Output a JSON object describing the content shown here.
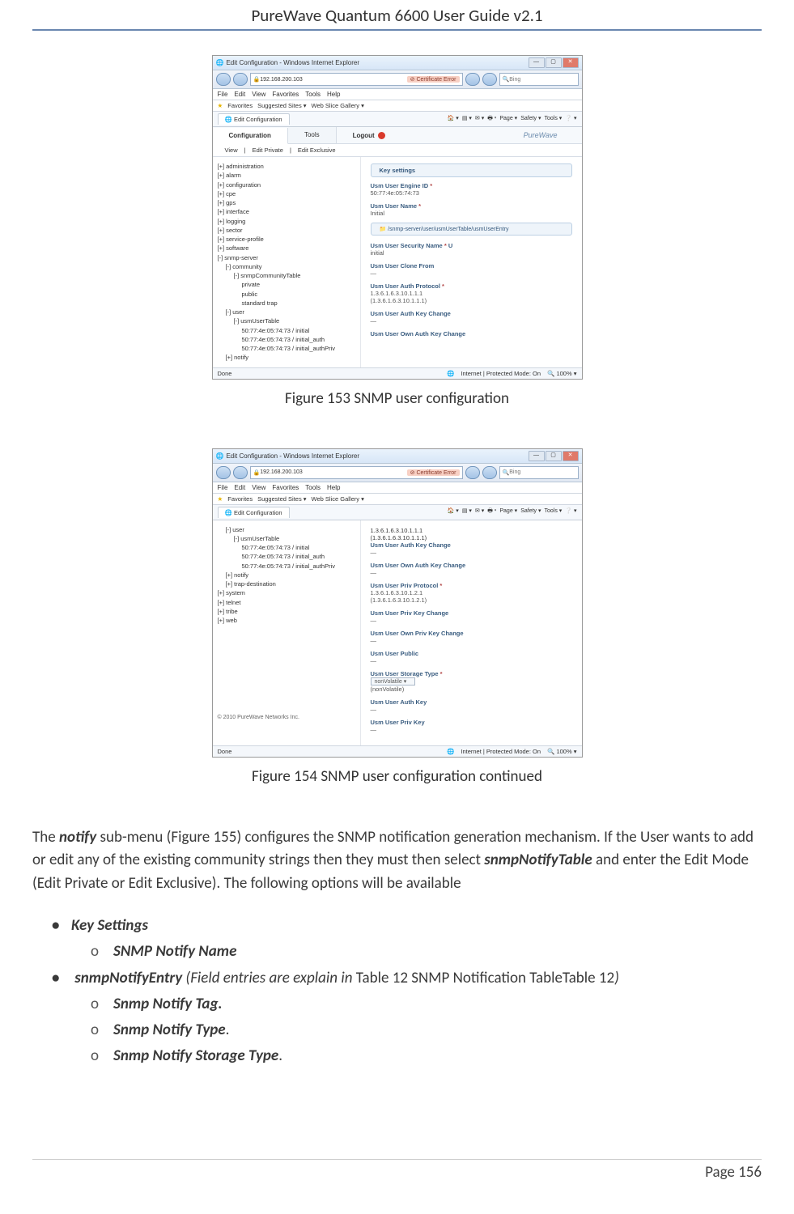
{
  "header": {
    "title": "PureWave Quantum 6600 User Guide v2.1"
  },
  "figures": {
    "f153": {
      "caption": "Figure 153 SNMP user configuration"
    },
    "f154": {
      "caption": "Figure 154 SNMP user configuration continued"
    }
  },
  "ie": {
    "window_title": "Edit Configuration - Windows Internet Explorer",
    "url_text": "192.168.200.103",
    "cert_error": "Certificate Error",
    "search_placeholder": "Bing",
    "menu": {
      "file": "File",
      "edit": "Edit",
      "view": "View",
      "favorites": "Favorites",
      "tools": "Tools",
      "help": "Help"
    },
    "favbar": {
      "label": "Favorites",
      "suggested": "Suggested Sites ▾",
      "gallery": "Web Slice Gallery ▾"
    },
    "tab_label": "Edit Configuration",
    "toolbar_right": {
      "page": "Page ▾",
      "safety": "Safety ▾",
      "tools": "Tools ▾"
    },
    "statusbar": {
      "done": "Done",
      "zone": "Internet | Protected Mode: On",
      "zoom": "100%  ▾"
    }
  },
  "pw": {
    "tabs": {
      "config": "Configuration",
      "tools": "Tools"
    },
    "logout": "Logout",
    "logo": "PureWave",
    "subtabs": {
      "view": "View",
      "edit_private": "Edit Private",
      "edit_exclusive": "Edit Exclusive"
    },
    "copyright": "© 2010 PureWave Networks Inc."
  },
  "tree153": {
    "administration": "[+] administration",
    "alarm": "[+] alarm",
    "configuration": "[+] configuration",
    "cpe": "[+] cpe",
    "gps": "[+] gps",
    "interface": "[+] interface",
    "logging": "[+] logging",
    "sector": "[+] sector",
    "service_profile": "[+] service-profile",
    "software": "[+] software",
    "snmp_server": "[-] snmp-server",
    "community": "[-] community",
    "snmpCommunityTable": "[-] snmpCommunityTable",
    "private": "private",
    "public": "public",
    "standard_trap": "standard trap",
    "user": "[-] user",
    "usmUserTable": "[-] usmUserTable",
    "u1": "50:77:4e:05:74:73 / initial",
    "u2": "50:77:4e:05:74:73 / initial_auth",
    "u3": "50:77:4e:05:74:73 / initial_authPriv",
    "notify": "[+] notify"
  },
  "tree154": {
    "user": "[-] user",
    "usmUserTable": "[-] usmUserTable",
    "u1": "50:77:4e:05:74:73 / initial",
    "u2": "50:77:4e:05:74:73 / initial_auth",
    "u3": "50:77:4e:05:74:73 / initial_authPriv",
    "notify": "[+] notify",
    "trap_dest": "[+] trap-destination",
    "system": "[+] system",
    "telnet": "[+] telnet",
    "tribe": "[+] tribe",
    "web": "[+] web"
  },
  "panel153": {
    "key_heading": "Key settings",
    "engine_id_lbl": "Usm User Engine ID",
    "engine_id_val": "50:77:4e:05:74:73",
    "user_name_lbl": "Usm User Name",
    "user_name_val": "Initial",
    "path": "/snmp-server/user/usmUserTable/usmUserEntry",
    "sec_name_lbl": "Usm User Security Name",
    "sec_name_val": "initial",
    "clone_lbl": "Usm User Clone From",
    "clone_val": "—",
    "auth_proto_lbl": "Usm User Auth Protocol",
    "auth_proto_val": "1.3.6.1.6.3.10.1.1.1",
    "auth_proto_paren": "(1.3.6.1.6.3.10.1.1.1)",
    "auth_key_lbl": "Usm User Auth Key Change",
    "auth_key_val": "—",
    "own_auth_key_lbl": "Usm User Own Auth Key Change"
  },
  "panel154": {
    "top_oid": "1.3.6.1.6.3.10.1.1.1",
    "top_oid_paren": "(1.3.6.1.6.3.10.1.1.1)",
    "auth_key_lbl": "Usm User Auth Key Change",
    "auth_key_val": "—",
    "own_auth_key_lbl": "Usm User Own Auth Key Change",
    "own_auth_key_val": "—",
    "priv_proto_lbl": "Usm User Priv Protocol",
    "priv_proto_val": "1.3.6.1.6.3.10.1.2.1",
    "priv_proto_paren": "(1.3.6.1.6.3.10.1.2.1)",
    "priv_key_lbl": "Usm User Priv Key Change",
    "priv_key_val": "—",
    "own_priv_key_lbl": "Usm User Own Priv Key Change",
    "own_priv_key_val": "—",
    "public_lbl": "Usm User Public",
    "public_val": "—",
    "storage_lbl": "Usm User Storage Type",
    "storage_select": "nonVolatile ▾",
    "storage_sub": "(nonVolatile)",
    "auth_key2_lbl": "Usm User Auth Key",
    "auth_key2_val": "—",
    "priv_key2_lbl": "Usm User Priv Key",
    "priv_key2_val": "—"
  },
  "para": {
    "t1": "The ",
    "notify": "notify",
    "t2": " sub-menu (Figure 155) configures the SNMP notification generation mechanism. If the User wants to add or edit any of the existing community strings then they must then select ",
    "snmpNotifyTable": "snmpNotifyTable",
    "t3": " and enter the Edit Mode (Edit Private or Edit Exclusive).   The following options will be available"
  },
  "list": {
    "key_settings": "Key Settings",
    "snmp_notify_name": "SNMP Notify Name",
    "entry_pre": "snmpNotifyEntry",
    "entry_mid": " (Field entries are explain in ",
    "entry_ref": "Table 12 SNMP Notification TableTable 12",
    "entry_end": ")",
    "tag": "Snmp Notify Tag.",
    "type": "Snmp Notify Type",
    "storage": "Snmp Notify Storage Type"
  },
  "footer": {
    "page": "Page 156"
  }
}
